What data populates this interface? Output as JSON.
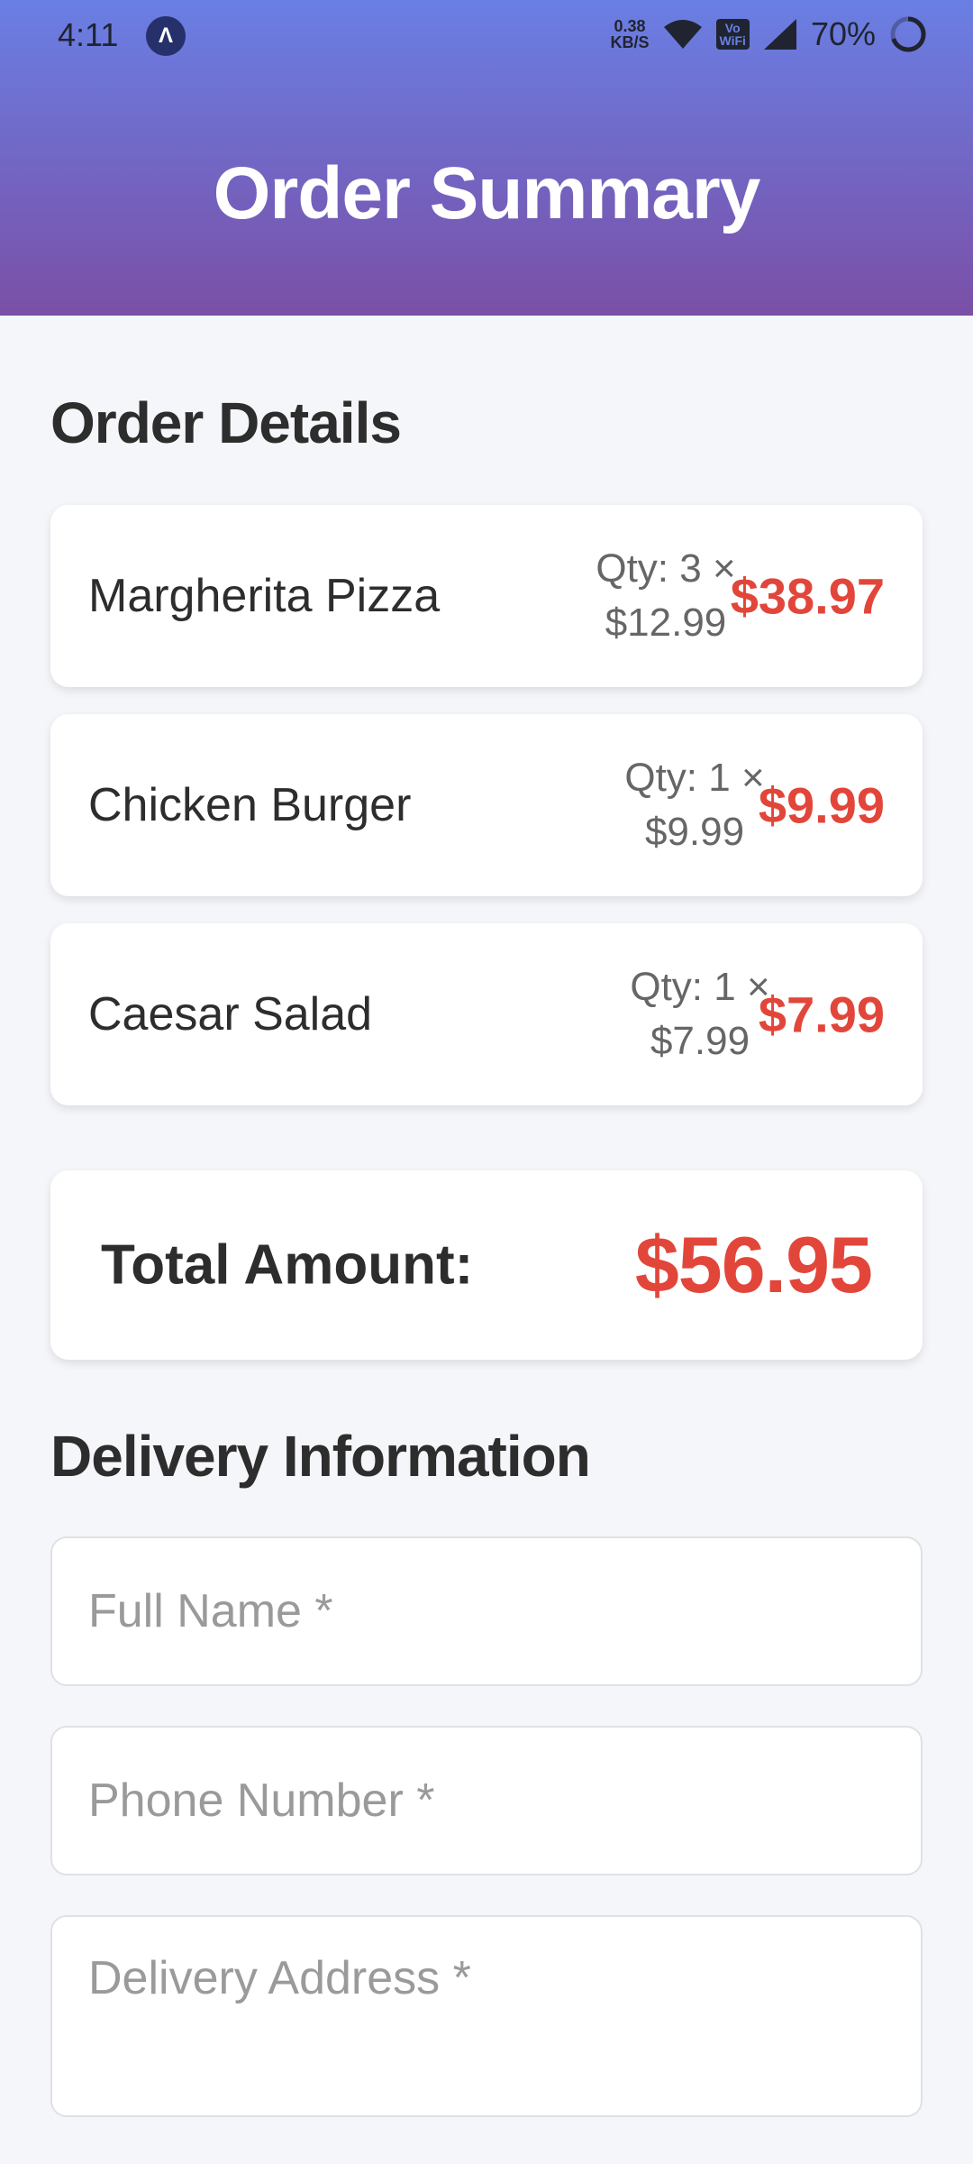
{
  "status_bar": {
    "time": "4:11",
    "app_icon": "Λ",
    "net_speed_value": "0.38",
    "net_speed_unit": "KB/S",
    "volte_top": "Vo",
    "volte_bottom": "WiFi",
    "battery": "70%"
  },
  "header": {
    "title": "Order Summary"
  },
  "order_details": {
    "title": "Order Details",
    "items": [
      {
        "name": "Margherita Pizza",
        "qty_line": "Qty: 3 ×",
        "unit_price": "$12.99",
        "total": "$38.97"
      },
      {
        "name": "Chicken Burger",
        "qty_line": "Qty: 1 ×",
        "unit_price": "$9.99",
        "total": "$9.99"
      },
      {
        "name": "Caesar Salad",
        "qty_line": "Qty: 1 ×",
        "unit_price": "$7.99",
        "total": "$7.99"
      }
    ]
  },
  "total": {
    "label": "Total Amount:",
    "value": "$56.95"
  },
  "delivery": {
    "title": "Delivery Information",
    "full_name_placeholder": "Full Name *",
    "phone_placeholder": "Phone Number *",
    "address_placeholder": "Delivery Address *"
  },
  "colors": {
    "header_top": "#6a7fe4",
    "header_bottom": "#7a4fa6",
    "price_accent": "#e2463a"
  }
}
